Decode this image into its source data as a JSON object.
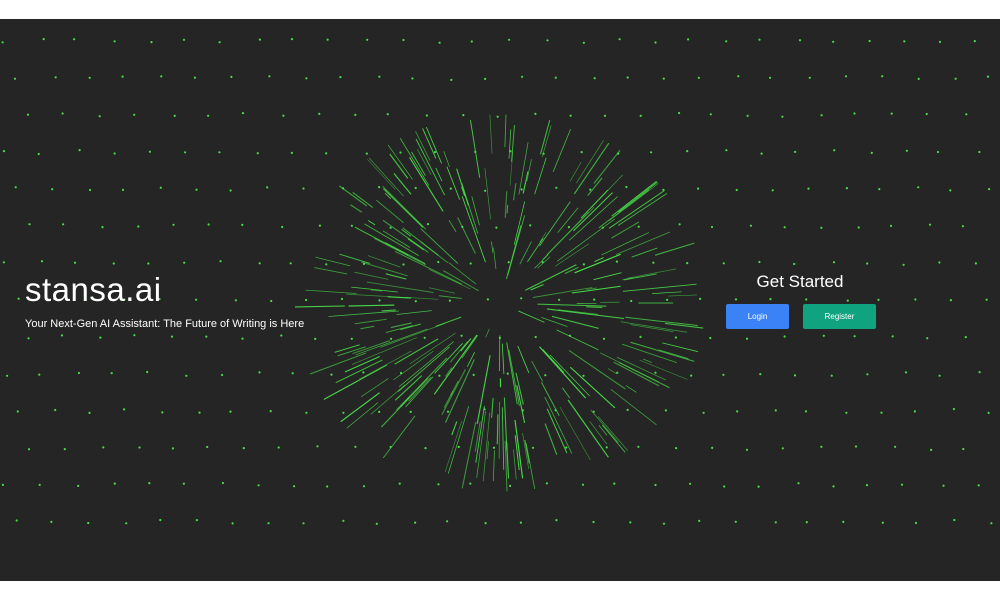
{
  "brand": {
    "title": "stansa.ai",
    "tagline": "Your Next-Gen AI Assistant: The Future of Writing is Here"
  },
  "cta": {
    "title": "Get Started",
    "login_label": "Login",
    "register_label": "Register"
  },
  "colors": {
    "background": "#252525",
    "accent_green": "#4ade4a",
    "login_button": "#3b82f6",
    "register_button": "#10a37f"
  }
}
